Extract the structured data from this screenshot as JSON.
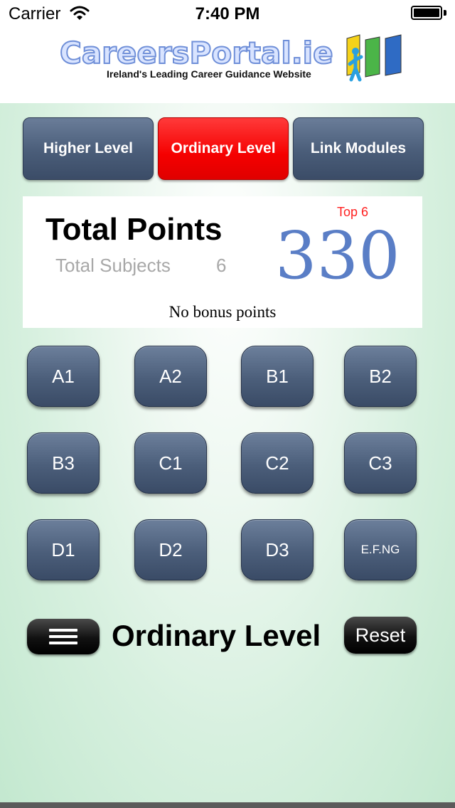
{
  "status_bar": {
    "carrier": "Carrier",
    "time": "7:40 PM"
  },
  "logo": {
    "name": "CareersPortal.ie",
    "tagline": "Ireland's Leading Career Guidance Website"
  },
  "tabs": [
    {
      "label": "Higher Level",
      "active": false
    },
    {
      "label": "Ordinary Level",
      "active": true
    },
    {
      "label": "Link Modules",
      "active": false
    }
  ],
  "points_panel": {
    "title": "Total Points",
    "subjects_label": "Total Subjects",
    "subjects_count": "6",
    "top_label": "Top 6",
    "total": "330",
    "bonus_text": "No bonus points"
  },
  "grades": [
    "A1",
    "A2",
    "B1",
    "B2",
    "B3",
    "C1",
    "C2",
    "C3",
    "D1",
    "D2",
    "D3",
    "E.F.NG"
  ],
  "bottom_bar": {
    "level_label": "Ordinary Level",
    "reset_label": "Reset",
    "menu_icon": "menu-icon"
  },
  "colors": {
    "active_tab": "#f50000",
    "button": "#4b5e7a",
    "points": "#5a7ec6",
    "top_label": "#ff2020"
  }
}
